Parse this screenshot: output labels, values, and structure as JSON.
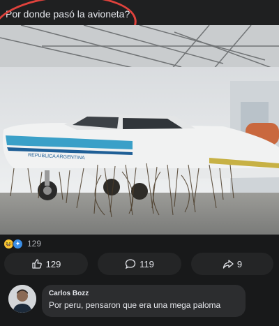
{
  "post": {
    "caption": "Por donde pasó la avioneta?",
    "image_alt": "Small white and blue airplane in a hangar covered in thin branches",
    "aircraft_text": "REPUBLICA ARGENTINA"
  },
  "reactions": {
    "icons": [
      "haha-emoji",
      "care-emoji"
    ],
    "count": "129"
  },
  "actions": {
    "like_count": "129",
    "comment_count": "119",
    "share_count": "9"
  },
  "comment": {
    "author": "Carlos Bozz",
    "text": "Por peru, pensaron que era una mega paloma"
  },
  "colors": {
    "background": "#18191a",
    "button_bg": "#242526",
    "bubble_bg": "#2c2d2f",
    "highlight_circle": "#e0423c",
    "text": "#e4e6eb"
  }
}
